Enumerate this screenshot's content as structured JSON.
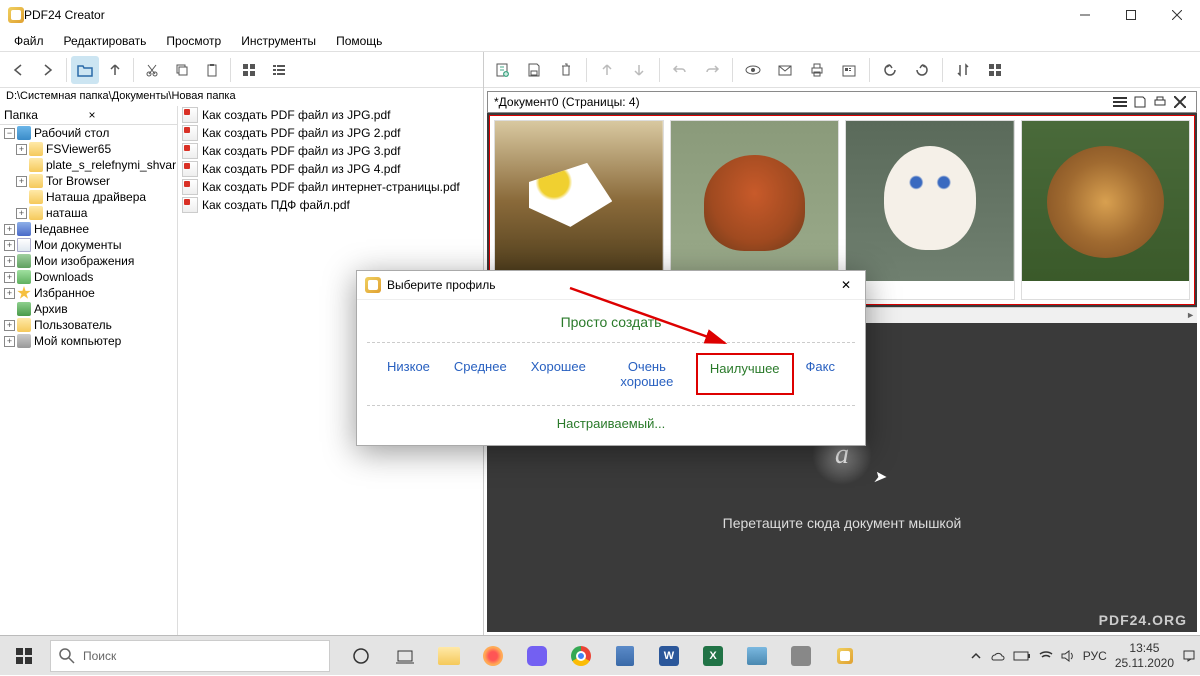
{
  "window": {
    "title": "PDF24 Creator"
  },
  "menu": {
    "file": "Файл",
    "edit": "Редактировать",
    "view": "Просмотр",
    "tools": "Инструменты",
    "help": "Помощь"
  },
  "path": "D:\\Системная папка\\Документы\\Новая папка",
  "tree": {
    "header": "Папка",
    "desktop": "Рабочий стол",
    "fsviewer": "FSViewer65",
    "plate": "plate_s_relefnymi_shvar",
    "tor": "Tor Browser",
    "natasha": "Наташа драйвера",
    "natasha2": "наташа",
    "recent": "Недавнее",
    "mydocs": "Мои документы",
    "myimg": "Мои изображения",
    "downloads": "Downloads",
    "fav": "Избранное",
    "archive": "Архив",
    "user": "Пользователь",
    "mycomp": "Мой компьютер"
  },
  "files": {
    "f1": "Как создать PDF файл из JPG.pdf",
    "f2": "Как создать PDF файл из JPG 2.pdf",
    "f3": "Как создать PDF файл из JPG 3.pdf",
    "f4": "Как создать PDF файл из JPG 4.pdf",
    "f5": "Как создать PDF файл интернет-страницы.pdf",
    "f6": "Как создать ПДФ файл.pdf"
  },
  "doc": {
    "title": "*Документ0 (Страницы: 4)"
  },
  "drop": {
    "text": "Перетащите сюда документ мышкой"
  },
  "watermark": "PDF24.ORG",
  "dialog": {
    "title": "Выберите профиль",
    "create": "Просто создать",
    "low": "Низкое",
    "med": "Среднее",
    "good": "Хорошее",
    "vgood": "Очень хорошее",
    "best": "Наилучшее",
    "fax": "Факс",
    "custom": "Настраиваемый..."
  },
  "taskbar": {
    "search": "Поиск",
    "lang": "РУС",
    "time": "13:45",
    "date": "25.11.2020"
  }
}
